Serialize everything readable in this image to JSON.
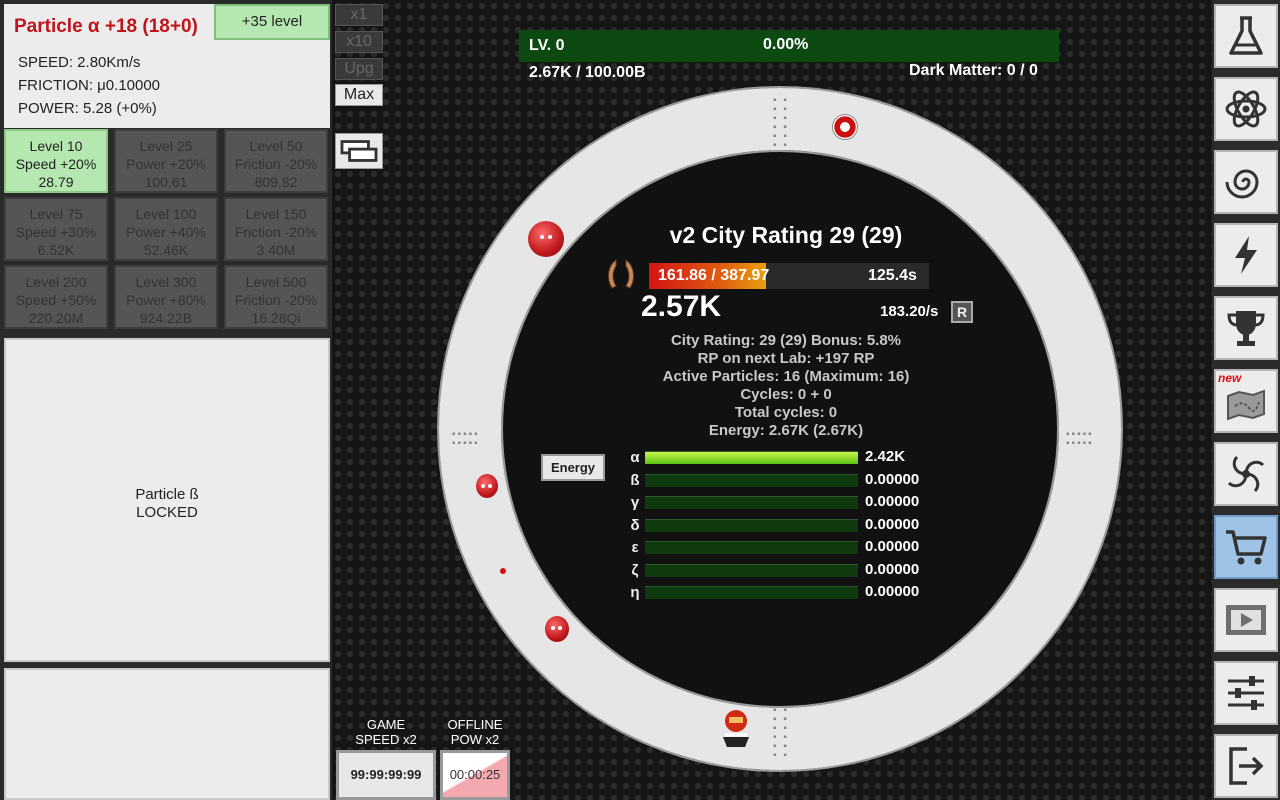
{
  "particle": {
    "title": "Particle α +18 (18+0)",
    "level_button": "+35 level",
    "speed": "SPEED: 2.80Km/s",
    "friction": "FRICTION: μ0.10000",
    "power": "POWER: 5.28 (+0%)"
  },
  "upgrades": [
    {
      "level": "Level 10",
      "effect": "Speed +20%",
      "cost": "28.79",
      "active": true
    },
    {
      "level": "Level 25",
      "effect": "Power +20%",
      "cost": "100.61",
      "active": false
    },
    {
      "level": "Level 50",
      "effect": "Friction -20%",
      "cost": "809.82",
      "active": false
    },
    {
      "level": "Level 75",
      "effect": "Speed +30%",
      "cost": "6.52K",
      "active": false
    },
    {
      "level": "Level 100",
      "effect": "Power +40%",
      "cost": "52.46K",
      "active": false
    },
    {
      "level": "Level 150",
      "effect": "Friction -20%",
      "cost": "3.40M",
      "active": false
    },
    {
      "level": "Level 200",
      "effect": "Speed +50%",
      "cost": "220.20M",
      "active": false
    },
    {
      "level": "Level 300",
      "effect": "Power +80%",
      "cost": "924.22B",
      "active": false
    },
    {
      "level": "Level 500",
      "effect": "Friction -20%",
      "cost": "16.28Qi",
      "active": false
    }
  ],
  "locked": {
    "line1": "Particle ß",
    "line2": "LOCKED"
  },
  "multipliers": {
    "x1": "x1",
    "x10": "x10",
    "upg": "Upg",
    "max": "Max"
  },
  "top": {
    "level": "LV. 0",
    "percent": "0.00%",
    "progress_text": "2.67K / 100.00B",
    "dark_matter": "Dark Matter: 0 / 0"
  },
  "city": {
    "title": "v2 City Rating 29 (29)",
    "rp": "161.86 / 387.97",
    "rp_fraction": 0.417,
    "time": "125.4s",
    "energy": "2.57K",
    "rate": "183.20/s",
    "r_button": "R",
    "info": [
      "City Rating: 29 (29) Bonus: 5.8%",
      "RP on next Lab: +197 RP",
      "Active Particles: 16 (Maximum: 16)",
      "Cycles: 0 + 0",
      "Total cycles: 0",
      "Energy: 2.67K (2.67K)"
    ]
  },
  "energy_button": "Energy",
  "energy_bars": [
    {
      "symbol": "α",
      "value": "2.42K",
      "fill": 1.0
    },
    {
      "symbol": "ß",
      "value": "0.00000",
      "fill": 0
    },
    {
      "symbol": "γ",
      "value": "0.00000",
      "fill": 0
    },
    {
      "symbol": "δ",
      "value": "0.00000",
      "fill": 0
    },
    {
      "symbol": "ε",
      "value": "0.00000",
      "fill": 0
    },
    {
      "symbol": "ζ",
      "value": "0.00000",
      "fill": 0
    },
    {
      "symbol": "η",
      "value": "0.00000",
      "fill": 0
    }
  ],
  "boosts": {
    "game_speed_label_1": "GAME",
    "game_speed_label_2": "SPEED x2",
    "game_speed_time": "99:99:99:99",
    "offline_label_1": "OFFLINE",
    "offline_label_2": "POW x2",
    "offline_time": "00:00:25"
  },
  "sidebar": [
    {
      "icon": "flask-icon"
    },
    {
      "icon": "atom-icon"
    },
    {
      "icon": "spiral-icon"
    },
    {
      "icon": "lightning-icon"
    },
    {
      "icon": "trophy-icon"
    },
    {
      "icon": "map-icon",
      "badge": "new"
    },
    {
      "icon": "vortex-icon"
    },
    {
      "icon": "cart-icon",
      "active": true
    },
    {
      "icon": "video-icon"
    },
    {
      "icon": "sliders-icon"
    },
    {
      "icon": "exit-icon"
    }
  ],
  "colors": {
    "title_red": "#c0141c",
    "active_green": "#b5e8b0",
    "level_bar": "#0c4a12",
    "sidebar_active": "#9fc3e6"
  }
}
